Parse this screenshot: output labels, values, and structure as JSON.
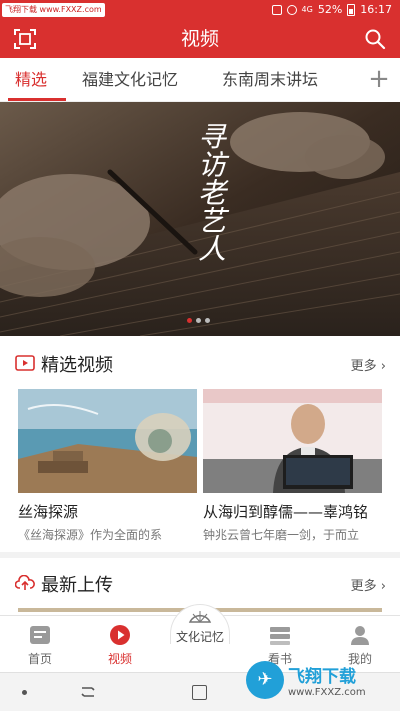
{
  "watermark_top": "飞翔下载 www.FXXZ.com",
  "status": {
    "network": "4G",
    "battery": "52%",
    "time": "16:17"
  },
  "header": {
    "title": "视频"
  },
  "tabs": [
    {
      "label": "精选",
      "active": true
    },
    {
      "label": "福建文化记忆",
      "active": false
    },
    {
      "label": "东南周末讲坛",
      "active": false
    }
  ],
  "tabs_add": "+",
  "banner": {
    "caption": "寻访老艺人",
    "slide_count": 3,
    "active_slide": 1
  },
  "featured": {
    "title": "精选视频",
    "more": "更多",
    "cards": [
      {
        "title": "丝海探源",
        "desc": "《丝海探源》作为全面的系"
      },
      {
        "title": "从海归到醇儒——辜鸿铭",
        "desc": "钟兆云曾七年磨一剑，于而立"
      }
    ]
  },
  "latest": {
    "title": "最新上传",
    "more": "更多"
  },
  "nav": {
    "home": "首页",
    "video": "视频",
    "culture": "文化记忆",
    "books": "看书",
    "mine": "我的",
    "active": "video"
  },
  "watermark_bottom": {
    "title": "飞翔下载",
    "url": "www.FXXZ.com"
  },
  "colors": {
    "brand_red": "#d9302f",
    "watermark_blue": "#21a0d8"
  }
}
